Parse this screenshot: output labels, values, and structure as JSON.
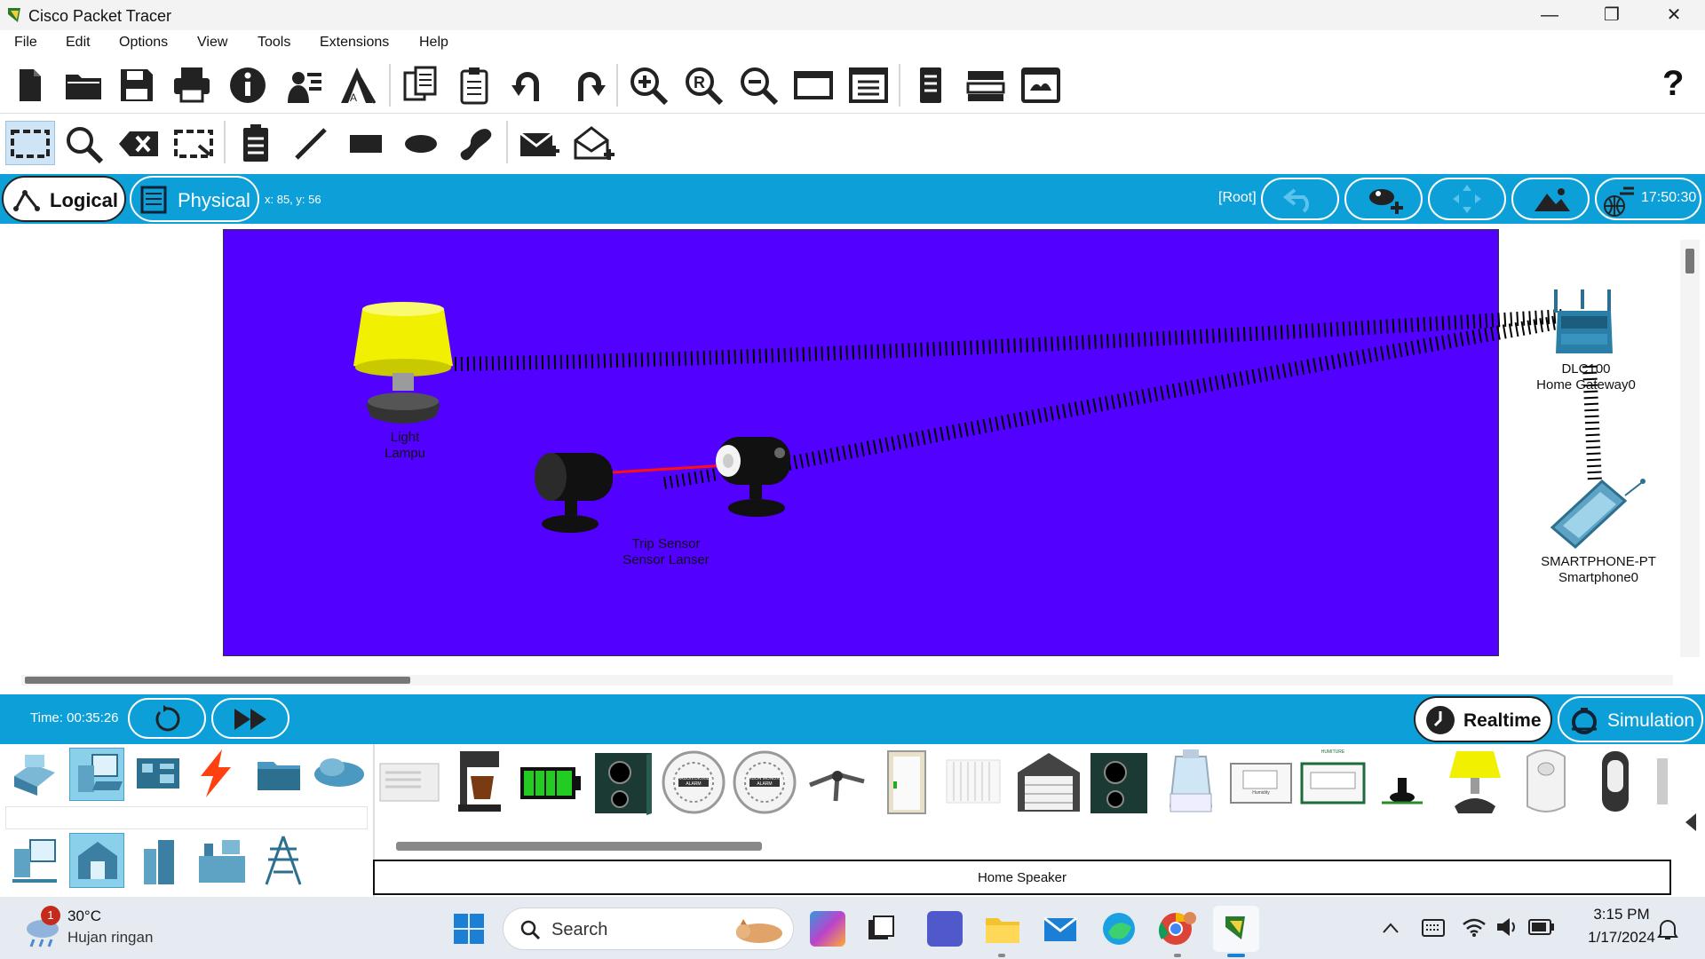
{
  "window": {
    "title": "Cisco Packet Tracer",
    "minimize": "—",
    "restore": "❐",
    "close": "✕"
  },
  "menu": [
    "File",
    "Edit",
    "Options",
    "View",
    "Tools",
    "Extensions",
    "Help"
  ],
  "help_glyph": "?",
  "mode_bar": {
    "logical_label": "Logical",
    "physical_label": "Physical",
    "coords": "x: 85, y: 56",
    "root_label": "[Root]",
    "clock": "17:50:30"
  },
  "devices": {
    "light_line1": "Light",
    "light_line2": "Lampu",
    "trip_line1": "Trip Sensor",
    "trip_line2": "Sensor Lanser",
    "gateway_line1": "DLC100",
    "gateway_line2": "Home Gateway0",
    "phone_line1": "SMARTPHONE-PT",
    "phone_line2": "Smartphone0"
  },
  "sim_bar": {
    "time_label": "Time: 00:35:26",
    "realtime_label": "Realtime",
    "simulation_label": "Simulation"
  },
  "device_panel": {
    "selected_device_name": "Home Speaker",
    "carbon_dioxide_text": "CARBON DIOXIDE ALARM",
    "carbon_monoxide_text": "CARBON MONOXIDE ALARM",
    "humidity_text": "Humidity",
    "humiture_text": "HUMITURE"
  },
  "taskbar": {
    "weather_badge": "1",
    "temperature": "30°C",
    "weather": "Hujan ringan",
    "search_placeholder": "Search",
    "time": "3:15 PM",
    "date": "1/17/2024"
  },
  "colors": {
    "accent": "#0c9fd8",
    "workspace": "#5200ff",
    "lamp_shade": "#f0f000",
    "laser": "#ff1010"
  }
}
